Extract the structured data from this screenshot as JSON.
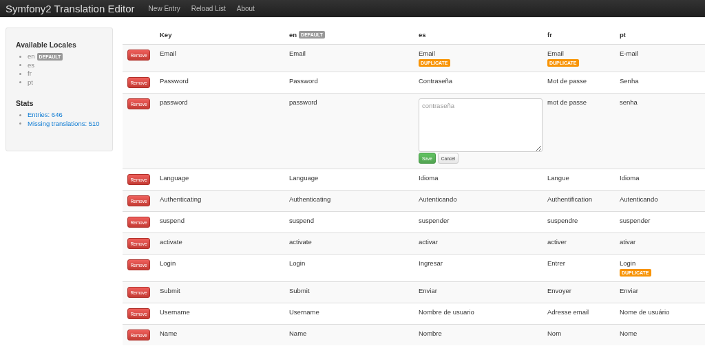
{
  "navbar": {
    "brand": "Symfony2 Translation Editor",
    "links": [
      "New Entry",
      "Reload List",
      "About"
    ]
  },
  "sidebar": {
    "locales_title": "Available Locales",
    "locales": [
      {
        "code": "en",
        "badge": "DEFAULT"
      },
      {
        "code": "es"
      },
      {
        "code": "fr"
      },
      {
        "code": "pt"
      }
    ],
    "stats_title": "Stats",
    "stats": [
      "Entries: 646",
      "Missing translations: 510"
    ]
  },
  "table": {
    "columns": [
      {
        "label": "Key"
      },
      {
        "label": "en",
        "badge": "DEFAULT"
      },
      {
        "label": "es"
      },
      {
        "label": "fr"
      },
      {
        "label": "pt"
      }
    ],
    "rows": [
      {
        "action": "Remove",
        "cells": [
          {
            "kind": "text",
            "text": "Email"
          },
          {
            "kind": "text",
            "text": "Email"
          },
          {
            "kind": "text",
            "text": "Email",
            "badge": "DUPLICATE"
          },
          {
            "kind": "text",
            "text": "Email",
            "badge": "DUPLICATE"
          },
          {
            "kind": "text",
            "text": "E-mail"
          }
        ]
      },
      {
        "action": "Remove",
        "cells": [
          {
            "kind": "text",
            "text": "Password"
          },
          {
            "kind": "text",
            "text": "Password"
          },
          {
            "kind": "text",
            "text": "Contraseña"
          },
          {
            "kind": "text",
            "text": "Mot de passe"
          },
          {
            "kind": "text",
            "text": "Senha"
          }
        ]
      },
      {
        "action": "Remove",
        "cells": [
          {
            "kind": "text",
            "text": "password"
          },
          {
            "kind": "text",
            "text": "password"
          },
          {
            "kind": "editor",
            "placeholder": "contraseña",
            "save": "Save",
            "cancel": "Cancel"
          },
          {
            "kind": "text",
            "text": "mot de passe"
          },
          {
            "kind": "text",
            "text": "senha"
          }
        ]
      },
      {
        "action": "Remove",
        "cells": [
          {
            "kind": "text",
            "text": "Language"
          },
          {
            "kind": "text",
            "text": "Language"
          },
          {
            "kind": "text",
            "text": "Idioma"
          },
          {
            "kind": "text",
            "text": "Langue"
          },
          {
            "kind": "text",
            "text": "Idioma"
          }
        ]
      },
      {
        "action": "Remove",
        "cells": [
          {
            "kind": "text",
            "text": "Authenticating"
          },
          {
            "kind": "text",
            "text": "Authenticating"
          },
          {
            "kind": "text",
            "text": "Autenticando"
          },
          {
            "kind": "text",
            "text": "Authentification"
          },
          {
            "kind": "text",
            "text": "Autenticando"
          }
        ]
      },
      {
        "action": "Remove",
        "cells": [
          {
            "kind": "text",
            "text": "suspend"
          },
          {
            "kind": "text",
            "text": "suspend"
          },
          {
            "kind": "text",
            "text": "suspender"
          },
          {
            "kind": "text",
            "text": "suspendre"
          },
          {
            "kind": "text",
            "text": "suspender"
          }
        ]
      },
      {
        "action": "Remove",
        "cells": [
          {
            "kind": "text",
            "text": "activate"
          },
          {
            "kind": "text",
            "text": "activate"
          },
          {
            "kind": "text",
            "text": "activar"
          },
          {
            "kind": "text",
            "text": "activer"
          },
          {
            "kind": "text",
            "text": "ativar"
          }
        ]
      },
      {
        "action": "Remove",
        "cells": [
          {
            "kind": "text",
            "text": "Login"
          },
          {
            "kind": "text",
            "text": "Login"
          },
          {
            "kind": "text",
            "text": "Ingresar"
          },
          {
            "kind": "text",
            "text": "Entrer"
          },
          {
            "kind": "text",
            "text": "Login",
            "badge": "DUPLICATE"
          }
        ]
      },
      {
        "action": "Remove",
        "cells": [
          {
            "kind": "text",
            "text": "Submit"
          },
          {
            "kind": "text",
            "text": "Submit"
          },
          {
            "kind": "text",
            "text": "Enviar"
          },
          {
            "kind": "text",
            "text": "Envoyer"
          },
          {
            "kind": "text",
            "text": "Enviar"
          }
        ]
      },
      {
        "action": "Remove",
        "cells": [
          {
            "kind": "text",
            "text": "Username"
          },
          {
            "kind": "text",
            "text": "Username"
          },
          {
            "kind": "text",
            "text": "Nombre de usuario"
          },
          {
            "kind": "text",
            "text": "Adresse email"
          },
          {
            "kind": "text",
            "text": "Nome de usuário"
          }
        ]
      },
      {
        "action": "Remove",
        "cells": [
          {
            "kind": "text",
            "text": "Name"
          },
          {
            "kind": "text",
            "text": "Name"
          },
          {
            "kind": "text",
            "text": "Nombre"
          },
          {
            "kind": "text",
            "text": "Nom"
          },
          {
            "kind": "text",
            "text": "Nome"
          }
        ]
      }
    ]
  }
}
